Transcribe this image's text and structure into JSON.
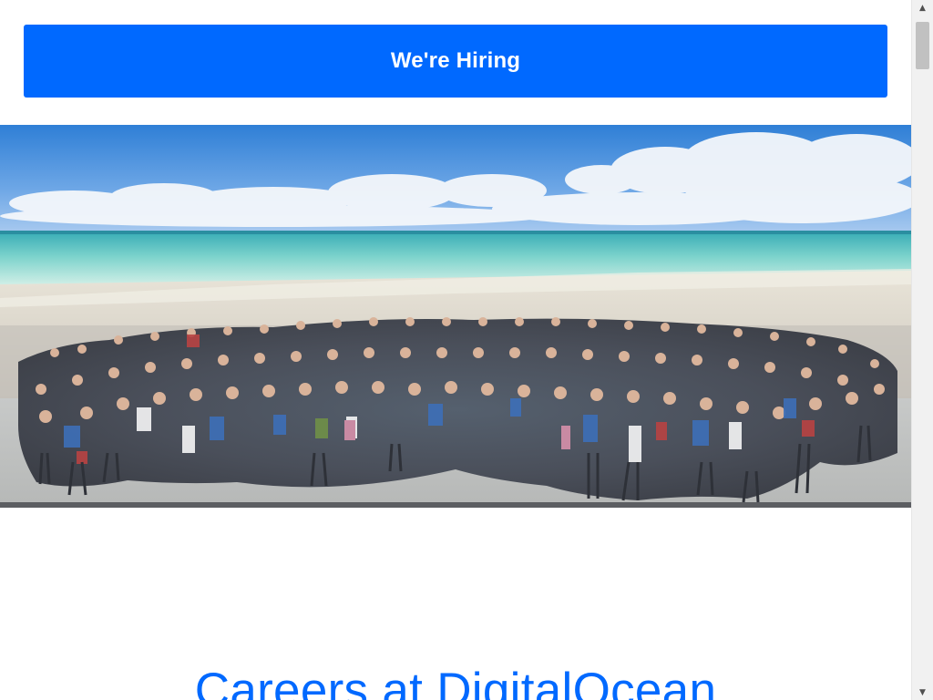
{
  "hiring_button": {
    "label": "We're Hiring"
  },
  "hero_image": {
    "alt": "Group photo of DigitalOcean employees on a beach"
  },
  "careers": {
    "title": "Careers at DigitalOcean"
  },
  "colors": {
    "brand_blue": "#0069ff",
    "scrollbar_track": "#f1f1f1",
    "scrollbar_thumb": "#c1c1c1"
  },
  "icons": {
    "scroll_up": "triangle-up-icon",
    "scroll_down": "triangle-down-icon"
  }
}
